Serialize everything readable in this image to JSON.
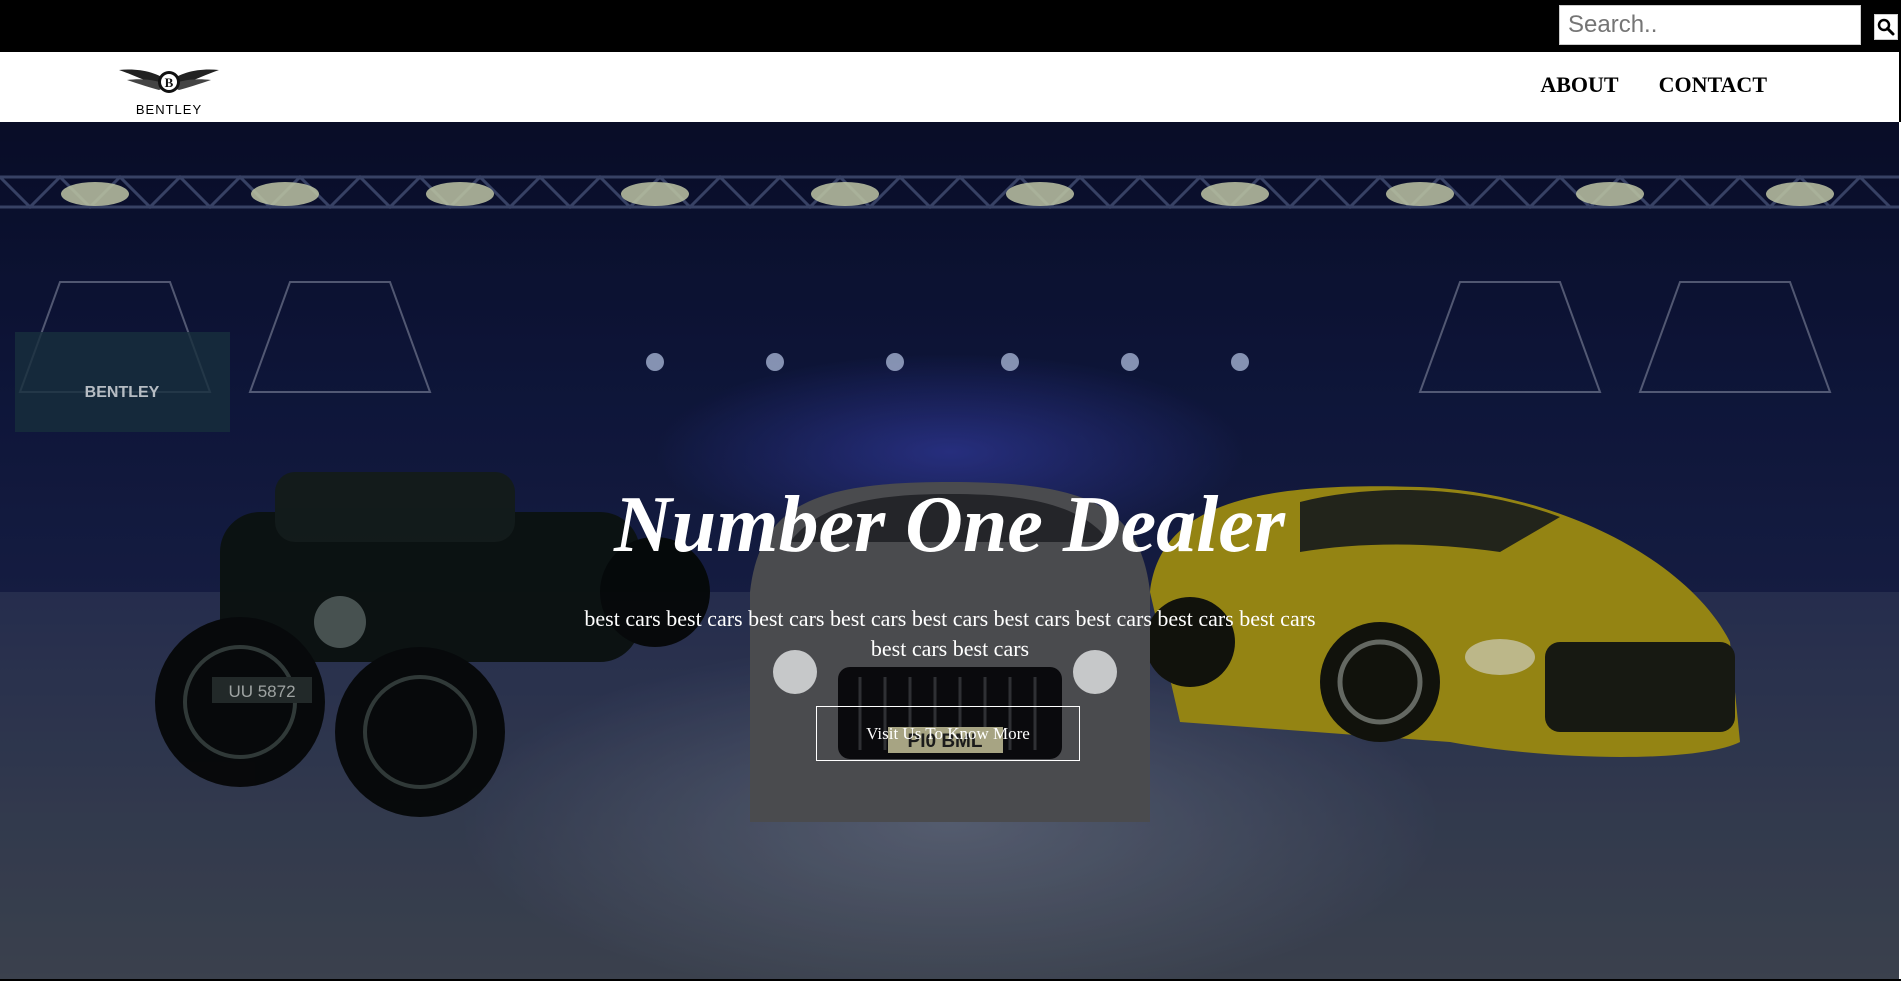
{
  "search": {
    "placeholder": "Search.."
  },
  "brand": {
    "logo_text": "BENTLEY"
  },
  "nav": {
    "items": [
      {
        "label": "ABOUT"
      },
      {
        "label": "CONTACT"
      }
    ]
  },
  "hero": {
    "title": "Number One Dealer",
    "text": "best cars best cars best cars best cars best cars best cars best cars best cars best cars best cars best cars",
    "button_label": "Visit Us To Know More",
    "banner_text": "BENTLEY",
    "plate_left": "UU 5872",
    "plate_center": "PI0 BML"
  },
  "colors": {
    "topbar": "#000000",
    "navbar": "#ffffff",
    "hero_text": "#ffffff",
    "car_yellow": "#c9b21a"
  },
  "icons": {
    "search": "magnifier-icon",
    "logo": "bentley-wings-icon"
  }
}
